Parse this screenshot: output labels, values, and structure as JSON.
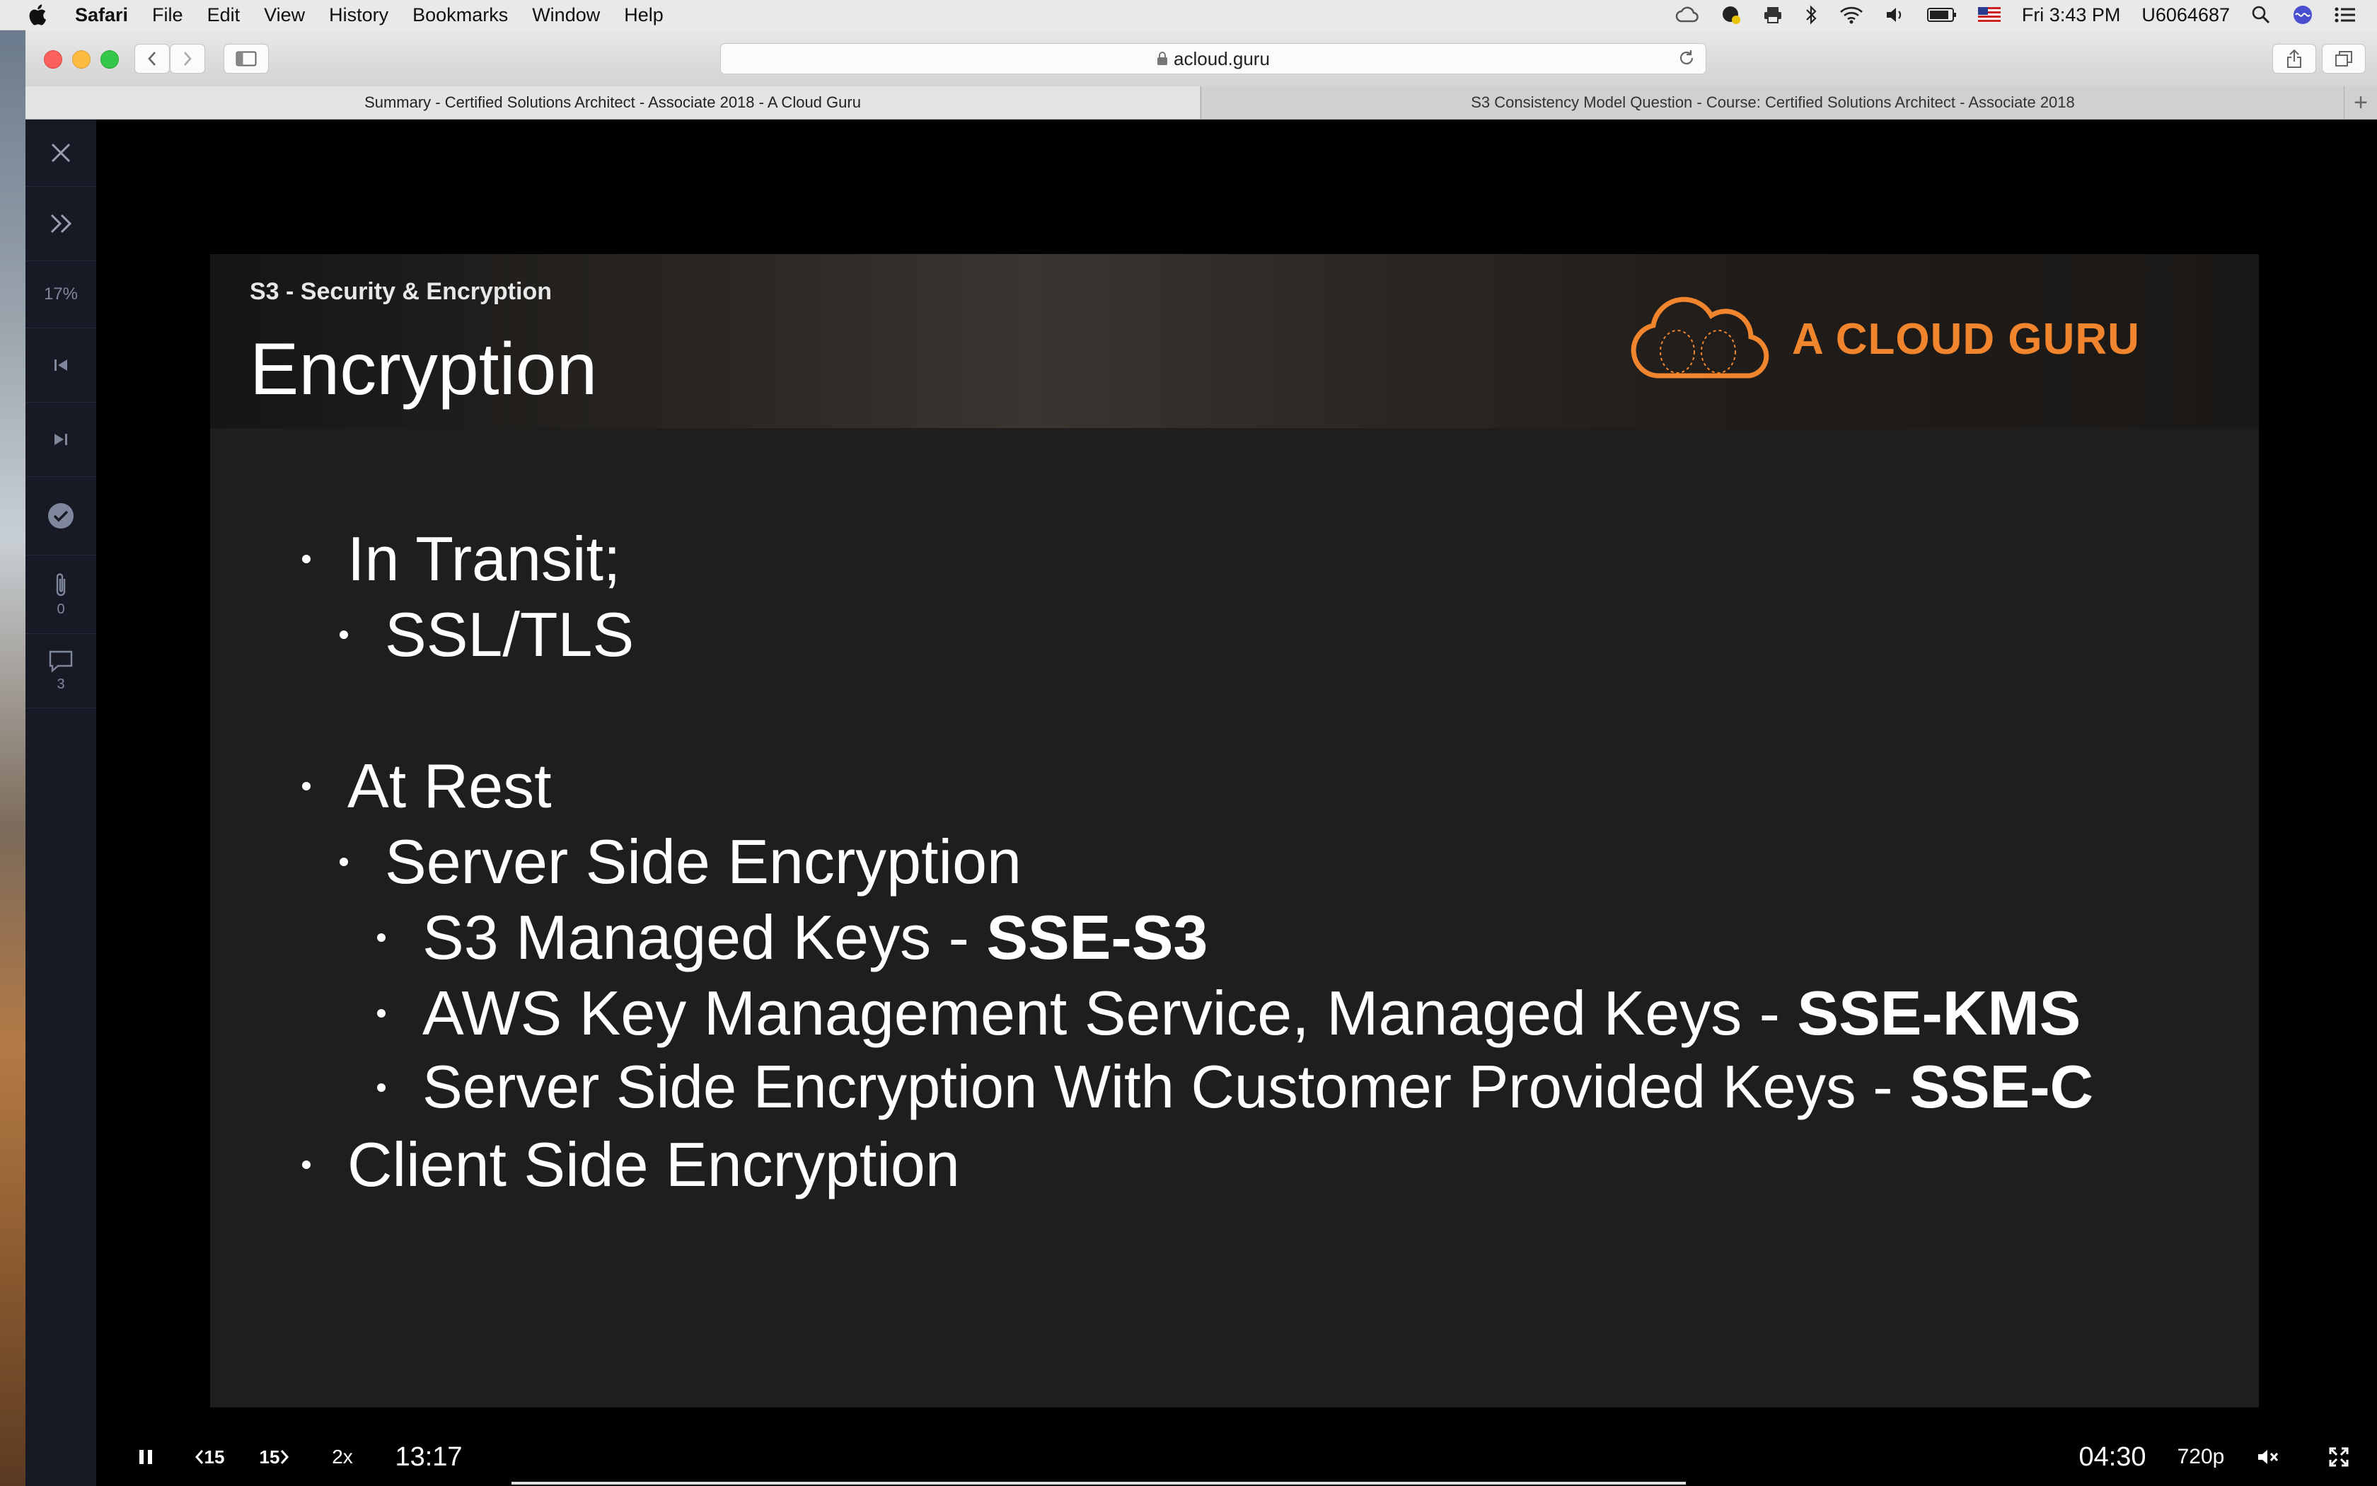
{
  "menubar": {
    "app": "Safari",
    "items": [
      "File",
      "Edit",
      "View",
      "History",
      "Bookmarks",
      "Window",
      "Help"
    ],
    "clock": "Fri 3:43 PM",
    "user": "U6064687"
  },
  "browser": {
    "url": "acloud.guru",
    "tabs": [
      {
        "label": "Summary - Certified Solutions Architect - Associate 2018 - A Cloud Guru",
        "active": true
      },
      {
        "label": "S3 Consistency Model Question - Course: Certified Solutions Architect - Associate 2018",
        "active": false
      }
    ]
  },
  "sidebar": {
    "progress": "17%",
    "attachments_count": "0",
    "comments_count": "3"
  },
  "slide": {
    "subtitle": "S3 - Security & Encryption",
    "title": "Encryption",
    "logo_text": "A CLOUD GURU",
    "bullets": [
      {
        "text": "In Transit;",
        "bold": ""
      },
      {
        "text": "SSL/TLS",
        "bold": ""
      },
      {
        "text": "At Rest",
        "bold": ""
      },
      {
        "text": "Server Side Encryption",
        "bold": ""
      },
      {
        "text": "S3 Managed Keys - ",
        "bold": "SSE-S3"
      },
      {
        "text": "AWS Key Management Service, Managed Keys - ",
        "bold": "SSE-KMS"
      },
      {
        "text": "Server Side Encryption With Customer Provided Keys - ",
        "bold": "SSE-C"
      },
      {
        "text": "Client Side Encryption",
        "bold": ""
      }
    ]
  },
  "player": {
    "rewind_label": "15",
    "forward_label": "15",
    "speed": "2x",
    "elapsed": "13:17",
    "remaining": "04:30",
    "quality": "720p",
    "progress": 0.76
  },
  "colors": {
    "accent_orange": "#f0852e",
    "sidebar_bg": "#171a25",
    "slide_bg": "#1e1e1e"
  }
}
